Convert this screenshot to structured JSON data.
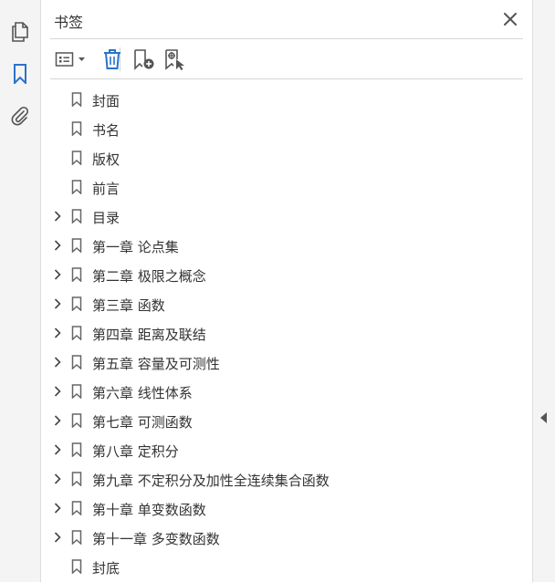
{
  "panel": {
    "title": "书签"
  },
  "icons": {
    "rail": [
      "pages-icon",
      "bookmark-icon",
      "attachment-icon"
    ],
    "toolbar": [
      "options-menu-icon",
      "delete-icon",
      "new-bookmark-icon",
      "bookmark-from-selection-icon"
    ],
    "close": "close-icon"
  },
  "colors": {
    "accent": "#2a73c8",
    "icon": "#555555"
  },
  "bookmarks": [
    {
      "label": "封面",
      "expandable": false
    },
    {
      "label": "书名",
      "expandable": false
    },
    {
      "label": "版权",
      "expandable": false
    },
    {
      "label": "前言",
      "expandable": false
    },
    {
      "label": "目录",
      "expandable": true
    },
    {
      "label": "第一章 论点集",
      "expandable": true
    },
    {
      "label": "第二章 极限之概念",
      "expandable": true
    },
    {
      "label": "第三章 函数",
      "expandable": true
    },
    {
      "label": "第四章 距离及联结",
      "expandable": true
    },
    {
      "label": "第五章 容量及可测性",
      "expandable": true
    },
    {
      "label": "第六章 线性体系",
      "expandable": true
    },
    {
      "label": "第七章 可测函数",
      "expandable": true
    },
    {
      "label": "第八章 定积分",
      "expandable": true
    },
    {
      "label": "第九章 不定积分及加性全连续集合函数",
      "expandable": true
    },
    {
      "label": "第十章 单变数函数",
      "expandable": true
    },
    {
      "label": "第十一章 多变数函数",
      "expandable": true
    },
    {
      "label": "封底",
      "expandable": false
    }
  ]
}
